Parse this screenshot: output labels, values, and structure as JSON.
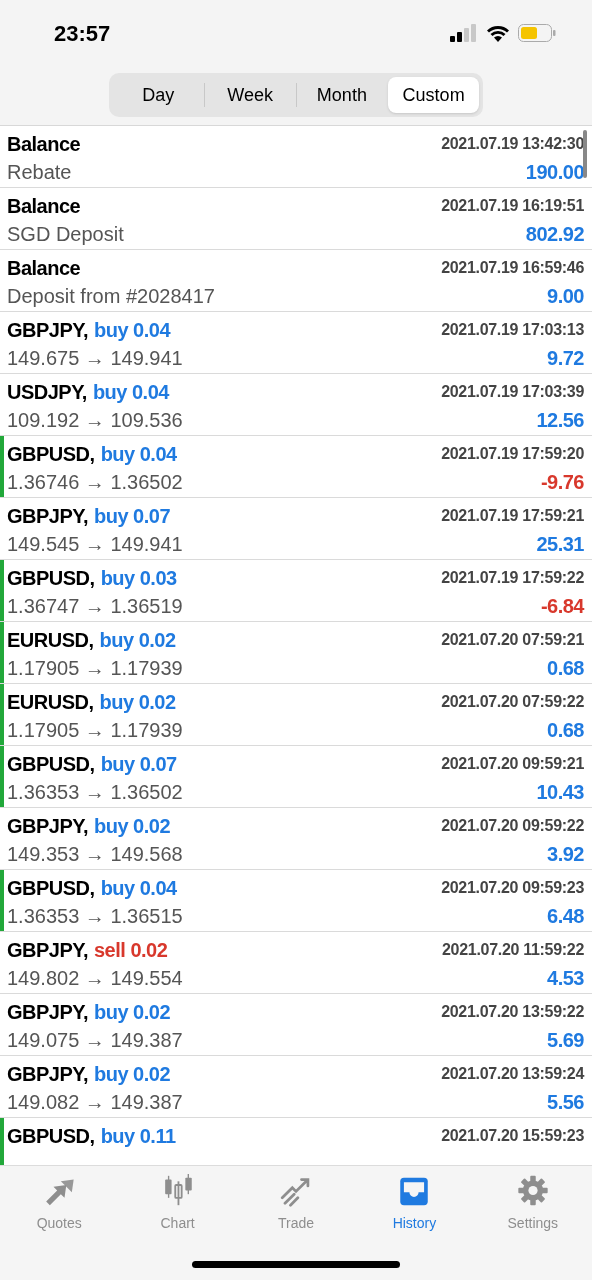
{
  "status_bar": {
    "time": "23:57"
  },
  "period_tabs": [
    {
      "label": "Day",
      "selected": false
    },
    {
      "label": "Week",
      "selected": false
    },
    {
      "label": "Month",
      "selected": false
    },
    {
      "label": "Custom",
      "selected": true
    }
  ],
  "history": [
    {
      "kind": "balance",
      "title": "Balance",
      "detail": "Rebate",
      "time": "2021.07.19 13:42:30",
      "profit": "190.00",
      "loss": false,
      "marked": false
    },
    {
      "kind": "balance",
      "title": "Balance",
      "detail": "SGD Deposit",
      "time": "2021.07.19 16:19:51",
      "profit": "802.92",
      "loss": false,
      "marked": false
    },
    {
      "kind": "balance",
      "title": "Balance",
      "detail": "Deposit from #2028417",
      "time": "2021.07.19 16:59:46",
      "profit": "9.00",
      "loss": false,
      "marked": false
    },
    {
      "kind": "trade",
      "title": "GBPJPY,",
      "sell": false,
      "action": "buy 0.04",
      "detail": "149.675 → 149.941",
      "time": "2021.07.19 17:03:13",
      "profit": "9.72",
      "loss": false,
      "marked": false
    },
    {
      "kind": "trade",
      "title": "USDJPY,",
      "sell": false,
      "action": "buy 0.04",
      "detail": "109.192 → 109.536",
      "time": "2021.07.19 17:03:39",
      "profit": "12.56",
      "loss": false,
      "marked": false
    },
    {
      "kind": "trade",
      "title": "GBPUSD,",
      "sell": false,
      "action": "buy 0.04",
      "detail": "1.36746 → 1.36502",
      "time": "2021.07.19 17:59:20",
      "profit": "-9.76",
      "loss": true,
      "marked": true
    },
    {
      "kind": "trade",
      "title": "GBPJPY,",
      "sell": false,
      "action": "buy 0.07",
      "detail": "149.545 → 149.941",
      "time": "2021.07.19 17:59:21",
      "profit": "25.31",
      "loss": false,
      "marked": false
    },
    {
      "kind": "trade",
      "title": "GBPUSD,",
      "sell": false,
      "action": "buy 0.03",
      "detail": "1.36747 → 1.36519",
      "time": "2021.07.19 17:59:22",
      "profit": "-6.84",
      "loss": true,
      "marked": true
    },
    {
      "kind": "trade",
      "title": "EURUSD,",
      "sell": false,
      "action": "buy 0.02",
      "detail": "1.17905 → 1.17939",
      "time": "2021.07.20 07:59:21",
      "profit": "0.68",
      "loss": false,
      "marked": true
    },
    {
      "kind": "trade",
      "title": "EURUSD,",
      "sell": false,
      "action": "buy 0.02",
      "detail": "1.17905 → 1.17939",
      "time": "2021.07.20 07:59:22",
      "profit": "0.68",
      "loss": false,
      "marked": true
    },
    {
      "kind": "trade",
      "title": "GBPUSD,",
      "sell": false,
      "action": "buy 0.07",
      "detail": "1.36353 → 1.36502",
      "time": "2021.07.20 09:59:21",
      "profit": "10.43",
      "loss": false,
      "marked": true
    },
    {
      "kind": "trade",
      "title": "GBPJPY,",
      "sell": false,
      "action": "buy 0.02",
      "detail": "149.353 → 149.568",
      "time": "2021.07.20 09:59:22",
      "profit": "3.92",
      "loss": false,
      "marked": false
    },
    {
      "kind": "trade",
      "title": "GBPUSD,",
      "sell": false,
      "action": "buy 0.04",
      "detail": "1.36353 → 1.36515",
      "time": "2021.07.20 09:59:23",
      "profit": "6.48",
      "loss": false,
      "marked": true
    },
    {
      "kind": "trade",
      "title": "GBPJPY,",
      "sell": true,
      "action": "sell 0.02",
      "detail": "149.802 → 149.554",
      "time": "2021.07.20 11:59:22",
      "profit": "4.53",
      "loss": false,
      "marked": false
    },
    {
      "kind": "trade",
      "title": "GBPJPY,",
      "sell": false,
      "action": "buy 0.02",
      "detail": "149.075 → 149.387",
      "time": "2021.07.20 13:59:22",
      "profit": "5.69",
      "loss": false,
      "marked": false
    },
    {
      "kind": "trade",
      "title": "GBPJPY,",
      "sell": false,
      "action": "buy 0.02",
      "detail": "149.082 → 149.387",
      "time": "2021.07.20 13:59:24",
      "profit": "5.56",
      "loss": false,
      "marked": false
    },
    {
      "kind": "trade",
      "title": "GBPUSD,",
      "sell": false,
      "action": "buy 0.11",
      "time": "2021.07.20 15:59:23",
      "marked": true
    }
  ],
  "tab_bar": [
    {
      "label": "Quotes",
      "selected": false
    },
    {
      "label": "Chart",
      "selected": false
    },
    {
      "label": "Trade",
      "selected": false
    },
    {
      "label": "History",
      "selected": true
    },
    {
      "label": "Settings",
      "selected": false
    }
  ]
}
